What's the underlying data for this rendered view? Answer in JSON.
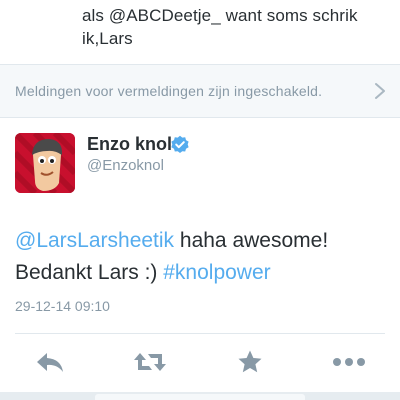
{
  "previous_tweet": {
    "line1": "als @ABCDeetje_  want soms schrik",
    "line2": "ik,Lars"
  },
  "notification": {
    "text": "Meldingen voor vermeldingen zijn ingeschakeld.",
    "icon": "chevron-right-icon"
  },
  "tweet": {
    "display_name": "Enzo knol",
    "handle": "@Enzoknol",
    "verified_icon": "verified-badge-icon",
    "text": {
      "mention": "@LarsLarsheetik",
      "part1": " haha awesome!",
      "part2": "Bedankt Lars :) ",
      "hashtag": "#knolpower"
    },
    "timestamp": "29-12-14 09:10"
  },
  "actions": {
    "reply_icon": "reply-icon",
    "retweet_icon": "retweet-icon",
    "favorite_icon": "star-icon",
    "more_icon": "more-icon"
  },
  "colors": {
    "link": "#55acee",
    "text": "#292f33",
    "muted": "#8899a6",
    "action_icon": "#8899a6",
    "avatar_bg": "#c8102e"
  }
}
